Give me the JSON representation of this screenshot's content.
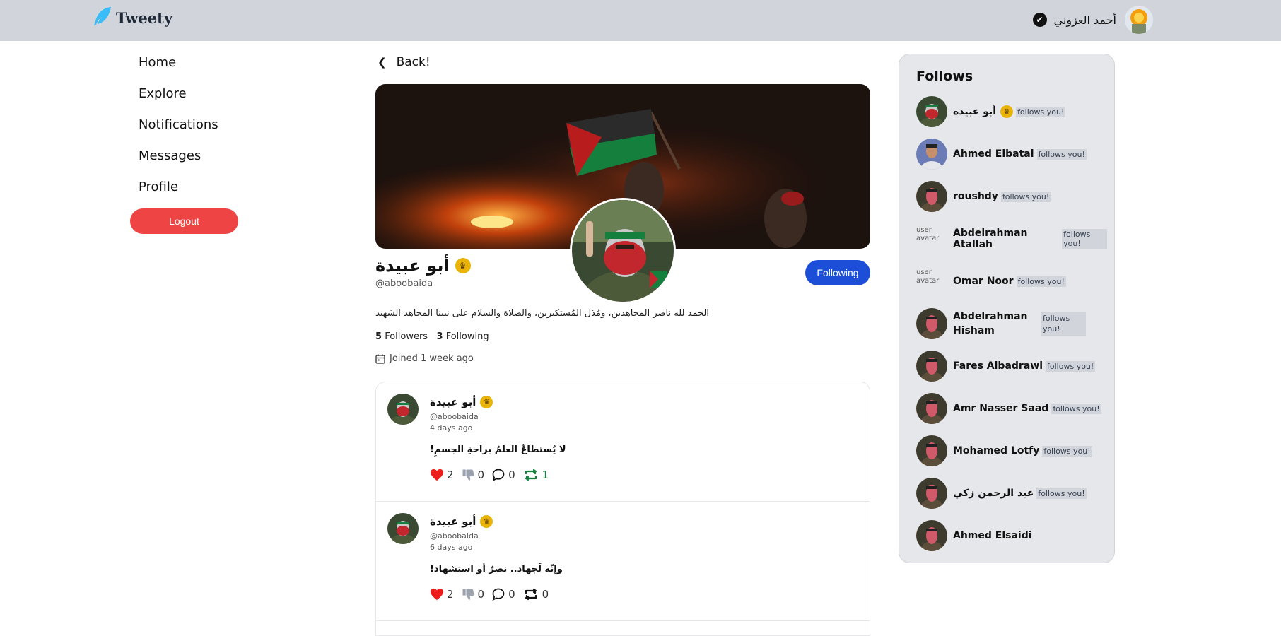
{
  "header": {
    "brand": "Tweety",
    "user_name": "أحمد العزوني"
  },
  "nav": {
    "items": [
      "Home",
      "Explore",
      "Notifications",
      "Messages",
      "Profile"
    ],
    "logout": "Logout"
  },
  "main": {
    "back_label": "Back!",
    "profile": {
      "name": "أبو عبيدة",
      "handle": "@aboobaida",
      "follow_button": "Following",
      "bio": "الحمد لله ناصر المجاهدين، ومُذل المُستكبرين، والصلاة والسلام على نبينا المجاهد الشهيد",
      "followers_count": "5",
      "followers_label": "Followers",
      "following_count": "3",
      "following_label": "Following",
      "joined": "Joined 1 week ago"
    },
    "tweets": [
      {
        "name": "أبو عبيدة",
        "handle": "@aboobaida",
        "time": "4 days ago",
        "text": "لا يُستطاعُ العلمُ براحةِ الجسمِ!",
        "likes": "2",
        "dislikes": "0",
        "comments": "0",
        "retweets": "1",
        "retweeted": true
      },
      {
        "name": "أبو عبيدة",
        "handle": "@aboobaida",
        "time": "6 days ago",
        "text": "وإنّه لَجهاد.. نصرٌ أو استشهاد!",
        "likes": "2",
        "dislikes": "0",
        "comments": "0",
        "retweets": "0",
        "retweeted": false
      }
    ]
  },
  "follows": {
    "title": "Follows",
    "badge": "follows you!",
    "avatar_alt": "user avatar",
    "items": [
      {
        "name": "أبو عبيدة",
        "badge": "follows you!",
        "verified": true
      },
      {
        "name": "Ahmed Elbatal",
        "badge": "follows you!"
      },
      {
        "name": "roushdy",
        "badge": "follows you!"
      },
      {
        "name": "Abdelrahman Atallah",
        "badge": "follows you!"
      },
      {
        "name": "Omar Noor",
        "badge": "follows you!"
      },
      {
        "name": "Abdelrahman Hisham",
        "badge": "follows you!"
      },
      {
        "name": "Fares Albadrawi",
        "badge": "follows you!"
      },
      {
        "name": "Amr Nasser Saad",
        "badge": "follows you!"
      },
      {
        "name": "Mohamed Lotfy",
        "badge": "follows you!"
      },
      {
        "name": "عبد الرحمن زكي",
        "badge": "follows you!"
      },
      {
        "name": "Ahmed Elsaidi",
        "badge": ""
      }
    ]
  },
  "colors": {
    "header_bg": "#d1d5db",
    "logout": "#ef4444",
    "following_btn": "#1d4ed8",
    "like": "#ef1c1c",
    "retweet_active": "#15803d",
    "crown": "#eab308"
  }
}
